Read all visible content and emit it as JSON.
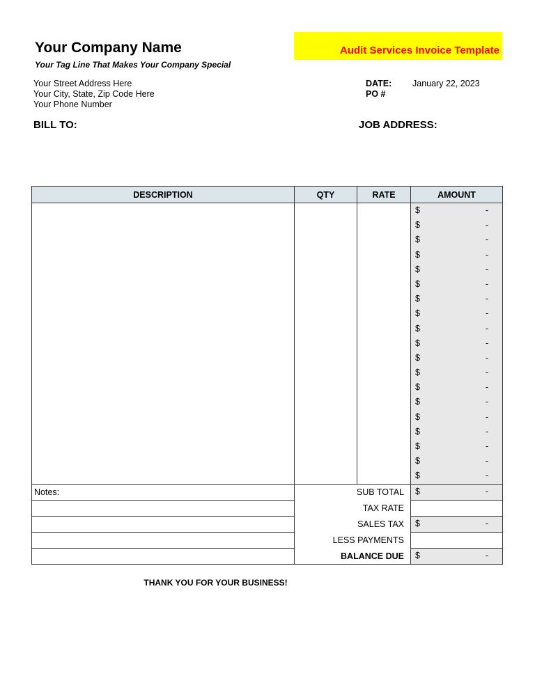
{
  "header": {
    "company_name": "Your Company Name",
    "tagline": "Your Tag Line That Makes Your Company Special",
    "title": "Audit Services Invoice Template",
    "title_bg_color": "#ffff00",
    "title_text_color": "#ff0000",
    "address_lines": [
      "Your Street Address Here",
      "Your City, State, Zip Code Here",
      "Your Phone Number"
    ],
    "date_label": "DATE:",
    "date_value": "January 22, 2023",
    "po_label": "PO #",
    "po_value": ""
  },
  "bill_to_label": "BILL TO:",
  "job_address_label": "JOB ADDRESS:",
  "table": {
    "columns": [
      "DESCRIPTION",
      "QTY",
      "RATE",
      "AMOUNT"
    ],
    "header_bg_color": "#dce6ea",
    "amount_bg_color": "#e8e8e8",
    "rows": [
      {
        "description": "",
        "qty": "",
        "rate": "",
        "currency": "$",
        "amount": "-"
      },
      {
        "description": "",
        "qty": "",
        "rate": "",
        "currency": "$",
        "amount": "-"
      },
      {
        "description": "",
        "qty": "",
        "rate": "",
        "currency": "$",
        "amount": "-"
      },
      {
        "description": "",
        "qty": "",
        "rate": "",
        "currency": "$",
        "amount": "-"
      },
      {
        "description": "",
        "qty": "",
        "rate": "",
        "currency": "$",
        "amount": "-"
      },
      {
        "description": "",
        "qty": "",
        "rate": "",
        "currency": "$",
        "amount": "-"
      },
      {
        "description": "",
        "qty": "",
        "rate": "",
        "currency": "$",
        "amount": "-"
      },
      {
        "description": "",
        "qty": "",
        "rate": "",
        "currency": "$",
        "amount": "-"
      },
      {
        "description": "",
        "qty": "",
        "rate": "",
        "currency": "$",
        "amount": "-"
      },
      {
        "description": "",
        "qty": "",
        "rate": "",
        "currency": "$",
        "amount": "-"
      },
      {
        "description": "",
        "qty": "",
        "rate": "",
        "currency": "$",
        "amount": "-"
      },
      {
        "description": "",
        "qty": "",
        "rate": "",
        "currency": "$",
        "amount": "-"
      },
      {
        "description": "",
        "qty": "",
        "rate": "",
        "currency": "$",
        "amount": "-"
      },
      {
        "description": "",
        "qty": "",
        "rate": "",
        "currency": "$",
        "amount": "-"
      },
      {
        "description": "",
        "qty": "",
        "rate": "",
        "currency": "$",
        "amount": "-"
      },
      {
        "description": "",
        "qty": "",
        "rate": "",
        "currency": "$",
        "amount": "-"
      },
      {
        "description": "",
        "qty": "",
        "rate": "",
        "currency": "$",
        "amount": "-"
      },
      {
        "description": "",
        "qty": "",
        "rate": "",
        "currency": "$",
        "amount": "-"
      },
      {
        "description": "",
        "qty": "",
        "rate": "",
        "currency": "$",
        "amount": "-"
      }
    ]
  },
  "notes_label": "Notes:",
  "notes_lines": [
    "",
    "",
    "",
    ""
  ],
  "summary": [
    {
      "label": "SUB TOTAL",
      "currency": "$",
      "value": "-",
      "shaded": true,
      "bold": false
    },
    {
      "label": "TAX RATE",
      "currency": "",
      "value": "",
      "shaded": false,
      "bold": false
    },
    {
      "label": "SALES TAX",
      "currency": "$",
      "value": "-",
      "shaded": true,
      "bold": false
    },
    {
      "label": "LESS PAYMENTS",
      "currency": "",
      "value": "",
      "shaded": false,
      "bold": false
    },
    {
      "label": "BALANCE DUE",
      "currency": "$",
      "value": "-",
      "shaded": true,
      "bold": true
    }
  ],
  "footer": "THANK YOU FOR YOUR BUSINESS!"
}
